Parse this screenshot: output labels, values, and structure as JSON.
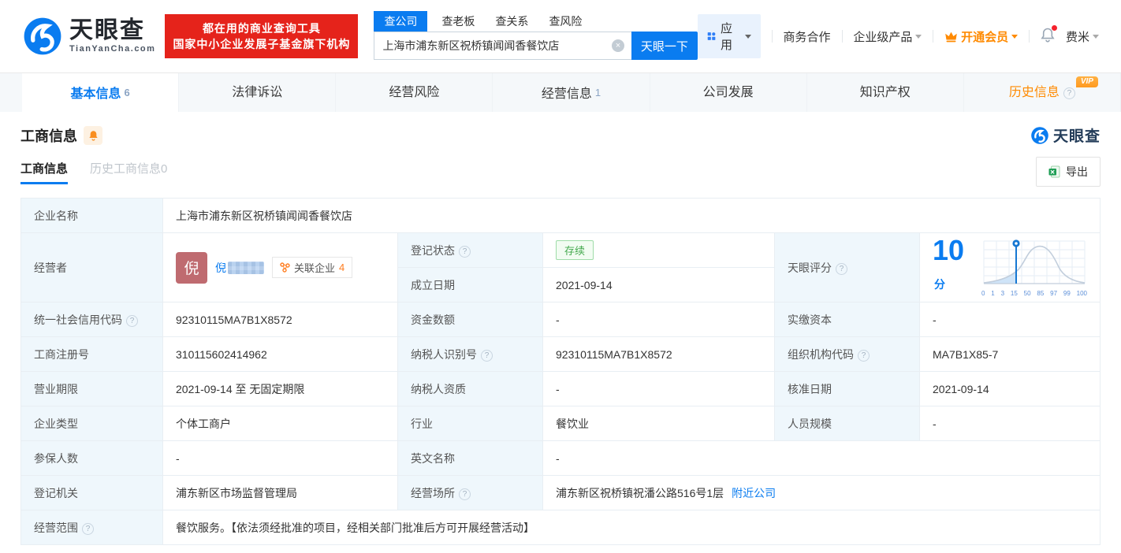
{
  "colors": {
    "brand_blue": "#0a7cf0",
    "promo_red": "#e5231b",
    "member_orange": "#ff8a00",
    "status_green": "#44a94e",
    "avatar_bg": "#bf6b70"
  },
  "header": {
    "logo_title": "天眼查",
    "logo_domain": "TianYanCha.com",
    "promo_line1": "都在用的商业查询工具",
    "promo_line2": "国家中小企业发展子基金旗下机构",
    "search_tabs": [
      {
        "label": "查公司"
      },
      {
        "label": "查老板"
      },
      {
        "label": "查关系"
      },
      {
        "label": "查风险"
      }
    ],
    "search_value": "上海市浦东新区祝桥镇闻闻香餐饮店",
    "search_button": "天眼一下",
    "nav_apps": "应用",
    "nav_biz": "商务合作",
    "nav_enterprise": "企业级产品",
    "nav_member": "开通会员",
    "nav_user": "费米"
  },
  "tabs": {
    "basic": {
      "label": "基本信息",
      "count": "6"
    },
    "legal": {
      "label": "法律诉讼"
    },
    "risk": {
      "label": "经营风险"
    },
    "operating": {
      "label": "经营信息",
      "count": "1"
    },
    "development": {
      "label": "公司发展"
    },
    "ip": {
      "label": "知识产权"
    },
    "history": {
      "label": "历史信息",
      "vip": "VIP"
    }
  },
  "section": {
    "title": "工商信息",
    "subtab_active": "工商信息",
    "subtab_history": "历史工商信息0",
    "brand": "天眼查",
    "export_label": "导出"
  },
  "biz": {
    "company_name": {
      "label": "企业名称",
      "value": "上海市浦东新区祝桥镇闻闻香餐饮店"
    },
    "operator": {
      "label": "经营者",
      "avatar_char": "倪",
      "name_visible": "倪",
      "related_label": "关联企业",
      "related_count": "4"
    },
    "reg_status": {
      "label": "登记状态",
      "value": "存续"
    },
    "establish_date": {
      "label": "成立日期",
      "value": "2021-09-14"
    },
    "score": {
      "label": "天眼评分"
    },
    "credit_code": {
      "label": "统一社会信用代码",
      "value": "92310115MA7B1X8572"
    },
    "capital": {
      "label": "资金数额",
      "value": "-"
    },
    "paid_capital": {
      "label": "实缴资本",
      "value": "-"
    },
    "reg_number": {
      "label": "工商注册号",
      "value": "310115602414962"
    },
    "taxpayer_id": {
      "label": "纳税人识别号",
      "value": "92310115MA7B1X8572"
    },
    "org_code": {
      "label": "组织机构代码",
      "value": "MA7B1X85-7"
    },
    "business_term": {
      "label": "营业期限",
      "value": "2021-09-14 至 无固定期限"
    },
    "taxpayer_quality": {
      "label": "纳税人资质",
      "value": "-"
    },
    "approval_date": {
      "label": "核准日期",
      "value": "2021-09-14"
    },
    "company_type": {
      "label": "企业类型",
      "value": "个体工商户"
    },
    "industry": {
      "label": "行业",
      "value": "餐饮业"
    },
    "staff_size": {
      "label": "人员规模",
      "value": "-"
    },
    "insured_count": {
      "label": "参保人数",
      "value": "-"
    },
    "english_name": {
      "label": "英文名称",
      "value": "-"
    },
    "reg_authority": {
      "label": "登记机关",
      "value": "浦东新区市场监督管理局"
    },
    "premises": {
      "label": "经营场所",
      "value": "浦东新区祝桥镇祝潘公路516号1层",
      "link": "附近公司"
    },
    "business_scope": {
      "label": "经营范围",
      "value": "餐饮服务。【依法须经批准的项目，经相关部门批准后方可开展经营活动】"
    }
  },
  "chart_data": {
    "type": "area",
    "title": "天眼评分",
    "score": "10",
    "score_unit": "分",
    "x_ticks": [
      "0",
      "1",
      "3",
      "15",
      "50",
      "85",
      "97",
      "99",
      "100"
    ],
    "marker_value": 10,
    "curve": "normal-distribution-of-scores",
    "legend": "none",
    "grid": "on"
  }
}
